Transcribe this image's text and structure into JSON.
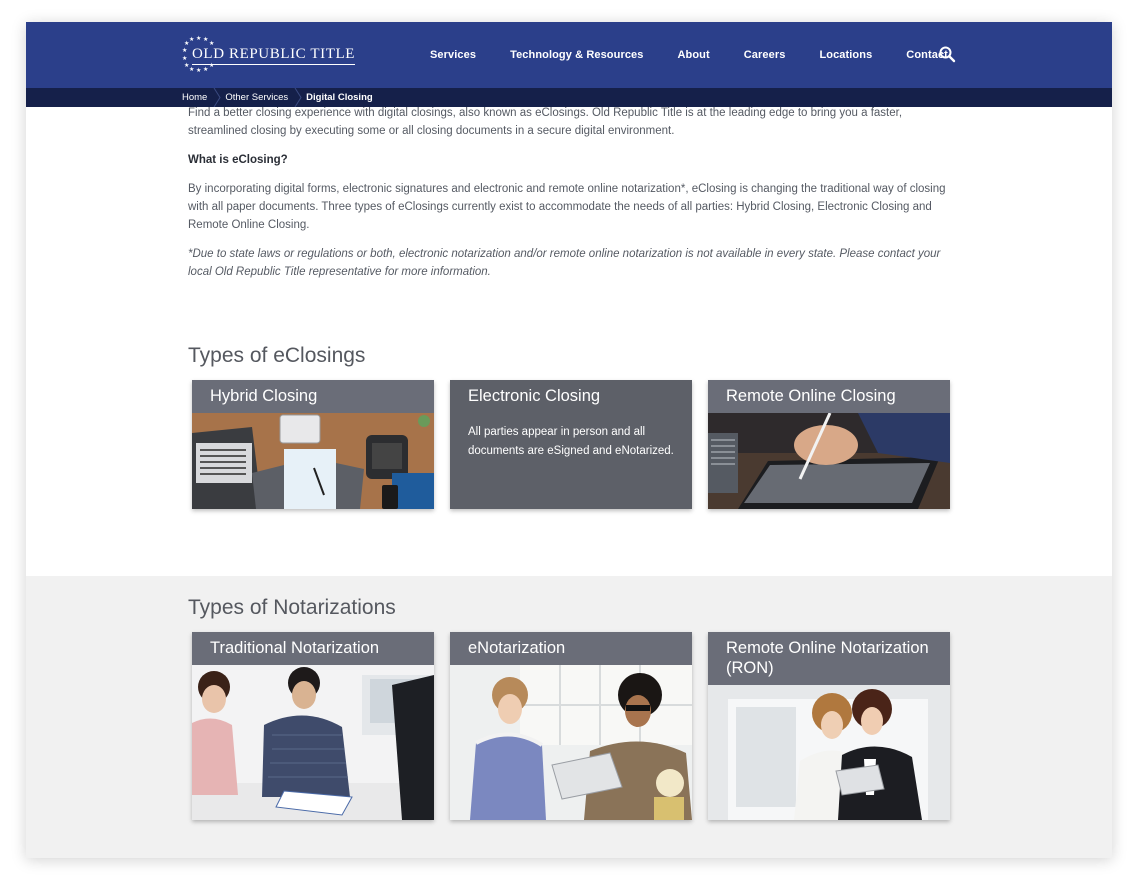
{
  "brand": {
    "name": "OLD REPUBLIC TITLE"
  },
  "nav": {
    "items": [
      "Services",
      "Technology & Resources",
      "About",
      "Careers",
      "Locations",
      "Contact"
    ],
    "search_icon": "search-icon"
  },
  "breadcrumb": {
    "items": [
      "Home",
      "Other Services"
    ],
    "current": "Digital Closing"
  },
  "intro": {
    "p1": "Find a better closing experience with digital closings, also known as eClosings. Old Republic Title is at the leading edge to bring you a faster, streamlined closing by executing some or all closing documents in a secure digital environment.",
    "heading": "What is eClosing?",
    "p2": "By incorporating digital forms, electronic signatures and electronic and remote online notarization*, eClosing is changing the traditional way of closing with all paper documents. Three types of eClosings currently exist to accommodate the needs of all parties: Hybrid Closing, Electronic Closing and Remote Online Closing.",
    "note": "*Due to state laws or regulations or both, electronic notarization and/or remote online notarization is not available in every state. Please contact your local Old Republic Title representative for more information."
  },
  "eclosings": {
    "title": "Types of eClosings",
    "cards": [
      {
        "label": "Hybrid Closing"
      },
      {
        "label": "Electronic Closing",
        "description": "All parties appear in person and all documents are eSigned and eNotarized."
      },
      {
        "label": "Remote Online Closing"
      }
    ]
  },
  "notarizations": {
    "title": "Types of Notarizations",
    "cards": [
      {
        "label": "Traditional Notarization"
      },
      {
        "label": "eNotarization"
      },
      {
        "label": "Remote Online Notarization (RON)"
      }
    ]
  },
  "colors": {
    "nav": "#2b3f8a",
    "breadcrumb": "#15204a",
    "card_header": "#6a6d78",
    "band": "#f1f1f1"
  }
}
